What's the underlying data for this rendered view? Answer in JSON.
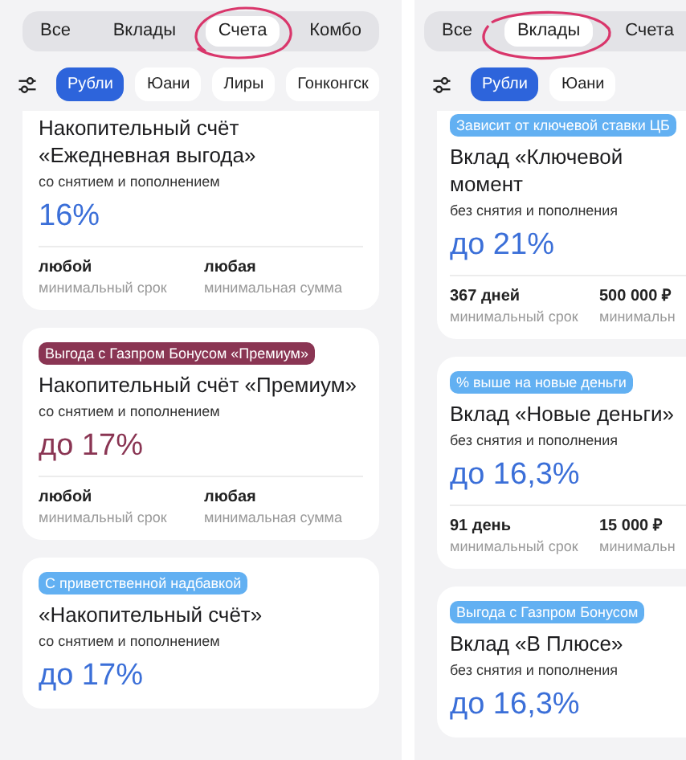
{
  "panels": [
    {
      "tabs": [
        {
          "label": "Все",
          "selected": false
        },
        {
          "label": "Вклады",
          "selected": false
        },
        {
          "label": "Счета",
          "selected": true
        },
        {
          "label": "Комбо",
          "selected": false
        }
      ],
      "chips": [
        {
          "label": "Рубли",
          "selected": true
        },
        {
          "label": "Юани",
          "selected": false
        },
        {
          "label": "Лиры",
          "selected": false
        },
        {
          "label": "Гонконгск",
          "selected": false
        }
      ],
      "cards": [
        {
          "title": "Накопительный счёт «Ежедневная выгода»",
          "subtitle": "со снятием и пополнением",
          "rate": "16%",
          "color": "#3b6fd8",
          "terms": [
            {
              "value": "любой",
              "label": "минимальный срок"
            },
            {
              "value": "любая",
              "label": "минимальная сумма"
            }
          ]
        },
        {
          "tag": {
            "text": "Выгода с Газпром Бонусом «Премиум»",
            "color": "#8a3553"
          },
          "title": "Накопительный счёт «Премиум»",
          "subtitle": "со снятием и пополнением",
          "rate": "до 17%",
          "color": "#8a3553",
          "terms": [
            {
              "value": "любой",
              "label": "минимальный срок"
            },
            {
              "value": "любая",
              "label": "минимальная сумма"
            }
          ]
        },
        {
          "tag": {
            "text": "С приветственной надбавкой",
            "color": "#62b0f2"
          },
          "title": "«Накопительный счёт»",
          "subtitle": "со снятием и пополнением",
          "rate": "до 17%",
          "color": "#3b6fd8"
        }
      ]
    },
    {
      "tabs": [
        {
          "label": "Все",
          "selected": false
        },
        {
          "label": "Вклады",
          "selected": true
        },
        {
          "label": "Счета",
          "selected": false
        }
      ],
      "chips": [
        {
          "label": "Рубли",
          "selected": true
        },
        {
          "label": "Юани",
          "selected": false
        }
      ],
      "cards": [
        {
          "tag": {
            "text": "Зависит от ключевой ставки ЦБ",
            "color": "#62b0f2"
          },
          "title": "Вклад «Ключевой момент",
          "subtitle": "без снятия и пополнения",
          "rate": "до 21%",
          "color": "#3b6fd8",
          "terms": [
            {
              "value": "367 дней",
              "label": "минимальный срок"
            },
            {
              "value": "500 000 ₽",
              "label": "минимальн"
            }
          ]
        },
        {
          "tag": {
            "text": "% выше на новые деньги",
            "color": "#62b0f2"
          },
          "title": "Вклад «Новые деньги»",
          "subtitle": "без снятия и пополнения",
          "rate": "до 16,3%",
          "color": "#3b6fd8",
          "terms": [
            {
              "value": "91 день",
              "label": "минимальный срок"
            },
            {
              "value": "15 000 ₽",
              "label": "минимальн"
            }
          ]
        },
        {
          "tag": {
            "text": "Выгода с Газпром Бонусом",
            "color": "#62b0f2"
          },
          "title": "Вклад «В Плюсе»",
          "subtitle": "без снятия и пополнения",
          "rate": "до 16,3%",
          "color": "#3b6fd8"
        }
      ]
    }
  ]
}
